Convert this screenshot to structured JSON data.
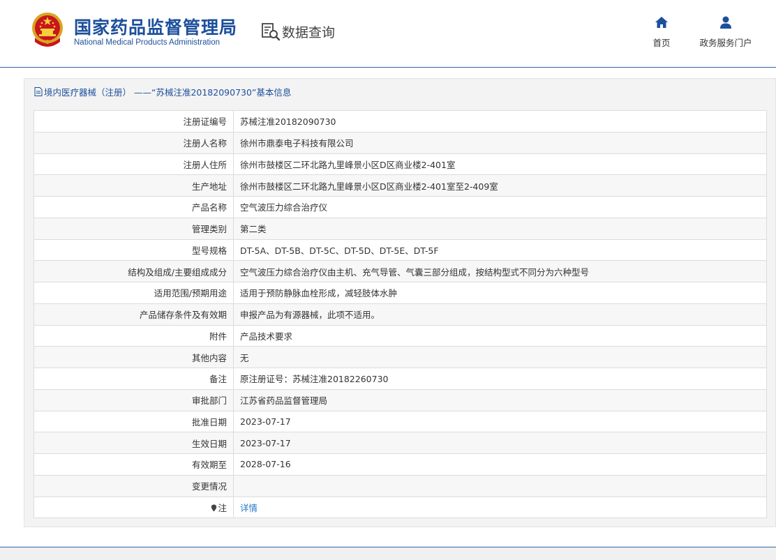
{
  "header": {
    "logo_cn": "国家药品监督管理局",
    "logo_en": "National Medical Products Administration",
    "query_label": "数据查询",
    "nav": [
      {
        "label": "首页",
        "icon": "home-icon"
      },
      {
        "label": "政务服务门户",
        "icon": "user-icon"
      }
    ]
  },
  "panel": {
    "title": "境内医疗器械（注册） ——“苏械注准20182090730”基本信息"
  },
  "rows": [
    {
      "label": "注册证编号",
      "value": "苏械注准20182090730"
    },
    {
      "label": "注册人名称",
      "value": "徐州市鼎泰电子科技有限公司"
    },
    {
      "label": "注册人住所",
      "value": "徐州市鼓楼区二环北路九里峰景小区D区商业楼2-401室"
    },
    {
      "label": "生产地址",
      "value": "徐州市鼓楼区二环北路九里峰景小区D区商业楼2-401室至2-409室"
    },
    {
      "label": "产品名称",
      "value": "空气波压力综合治疗仪"
    },
    {
      "label": "管理类别",
      "value": "第二类"
    },
    {
      "label": "型号规格",
      "value": "DT-5A、DT-5B、DT-5C、DT-5D、DT-5E、DT-5F"
    },
    {
      "label": "结构及组成/主要组成成分",
      "value": "空气波压力综合治疗仪由主机、充气导管、气囊三部分组成，按结构型式不同分为六种型号"
    },
    {
      "label": "适用范围/预期用途",
      "value": "适用于预防静脉血栓形成，减轻肢体水肿"
    },
    {
      "label": "产品储存条件及有效期",
      "value": "申报产品为有源器械，此项不适用。"
    },
    {
      "label": "附件",
      "value": "产品技术要求"
    },
    {
      "label": "其他内容",
      "value": "无"
    },
    {
      "label": "备注",
      "value": "原注册证号：苏械注准20182260730"
    },
    {
      "label": "审批部门",
      "value": "江苏省药品监督管理局"
    },
    {
      "label": "批准日期",
      "value": "2023-07-17"
    },
    {
      "label": "生效日期",
      "value": "2023-07-17"
    },
    {
      "label": "有效期至",
      "value": "2028-07-16"
    },
    {
      "label": "变更情况",
      "value": ""
    }
  ],
  "note_row": {
    "label": "注",
    "link": "详情"
  },
  "colors": {
    "brand": "#1c4f9c",
    "link": "#2a78c8",
    "divider": "#2a65b0"
  }
}
